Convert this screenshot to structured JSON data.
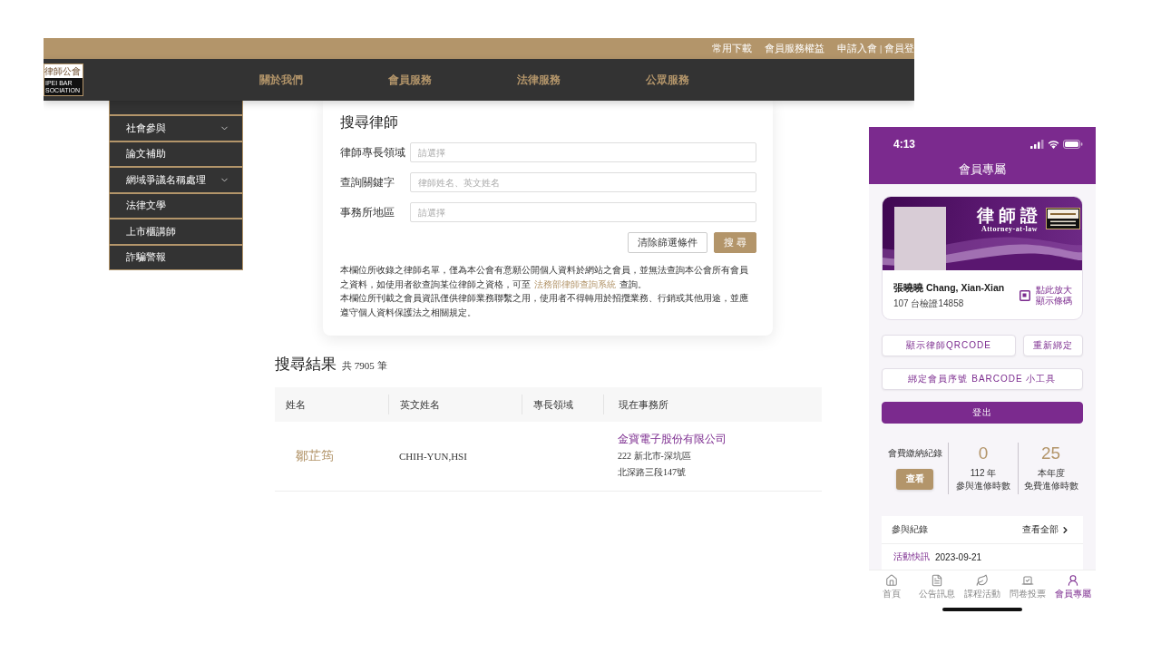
{
  "website": {
    "top_links": [
      "常用下載",
      "會員服務權益",
      "申請入會 | 會員登"
    ],
    "logo": {
      "chinese": "律師公會",
      "english_lines": [
        "IPEI BAR",
        "SOCIATION"
      ]
    },
    "nav": [
      "關於我們",
      "會員服務",
      "法律服務",
      "公眾服務"
    ],
    "sidebar": {
      "items": [
        {
          "label": "社會參與",
          "expandable": true
        },
        {
          "label": "論文補助",
          "expandable": false
        },
        {
          "label": "網域爭議名稱處理",
          "expandable": true
        },
        {
          "label": "法律文學",
          "expandable": false
        },
        {
          "label": "上市櫃講師",
          "expandable": false
        },
        {
          "label": "詐騙警報",
          "expandable": false
        }
      ]
    },
    "search_form": {
      "title": "搜尋律師",
      "fields": [
        {
          "label": "律師專長領域",
          "placeholder": "請選擇"
        },
        {
          "label": "查詢關鍵字",
          "placeholder": "律師姓名、英文姓名"
        },
        {
          "label": "事務所地區",
          "placeholder": "請選擇"
        }
      ],
      "buttons": [
        {
          "label": "清除篩選條件",
          "kind": "secondary"
        },
        {
          "label": "搜 尋",
          "kind": "primary"
        }
      ],
      "notes": [
        {
          "text": "本欄位所收錄之律師名單，僅為本公會有意願公開個人資料於網站之會員，並無法查詢本公會所有會員之資料，如使用者欲查詢某位律師之資格，可至",
          "link": "法務部律師查詢系統",
          "text_after": "查詢。"
        },
        {
          "text": "本欄位所刊載之會員資訊僅供律師業務聯繫之用，使用者不得轉用於招攬業務、行銷或其他用途，並應遵守個人資料保護法之相關規定。"
        }
      ]
    },
    "results": {
      "title": "搜尋結果",
      "count": "共 7905 筆",
      "columns": [
        "姓名",
        "英文姓名",
        "專長領域",
        "現在事務所"
      ],
      "rows": [
        {
          "name": "鄒芷筠",
          "english_name": "CHIH-YUN,HSI",
          "office": {
            "name": "金寶電子股份有限公司",
            "address_lines": [
              "222 新北市-深坑區",
              "北深路三段147號"
            ]
          }
        }
      ]
    }
  },
  "phone": {
    "status_bar": {
      "time": "4:13"
    },
    "title": "會員專屬",
    "member_card": {
      "title": "律師證",
      "subtitle": "Attorney-at-law",
      "name": "張曉曉 Chang, Xian-Xian",
      "certificate": "107 台檢證14858",
      "zoom_hint": "點此放大顯示條碼"
    },
    "button_rows": [
      [
        {
          "label": "顯示律師QRCODE",
          "kind": "outline"
        },
        {
          "label": "重新綁定",
          "kind": "outline"
        }
      ],
      [
        {
          "label": "綁定會員序號 BARCODE 小工具",
          "kind": "outline"
        }
      ],
      [
        {
          "label": "登出",
          "kind": "filled"
        }
      ]
    ],
    "fee_record": {
      "title": "會費繳納紀錄",
      "button": "查看"
    },
    "hour_stats": [
      {
        "value": "0",
        "caption_lines": [
          "112 年",
          "參與進修時數"
        ]
      },
      {
        "value": "25",
        "caption_lines": [
          "本年度",
          "免費進修時數"
        ]
      }
    ],
    "records": {
      "title": "參與紀錄",
      "view_all": "查看全部",
      "items": [
        {
          "category": "活動快訊",
          "date": "2023-09-21"
        }
      ]
    },
    "tab_bar": [
      {
        "label": "首頁",
        "selected": false
      },
      {
        "label": "公告訊息",
        "selected": false
      },
      {
        "label": "課程活動",
        "selected": false
      },
      {
        "label": "問卷投票",
        "selected": false
      },
      {
        "label": "會員專屬",
        "selected": true
      }
    ]
  }
}
